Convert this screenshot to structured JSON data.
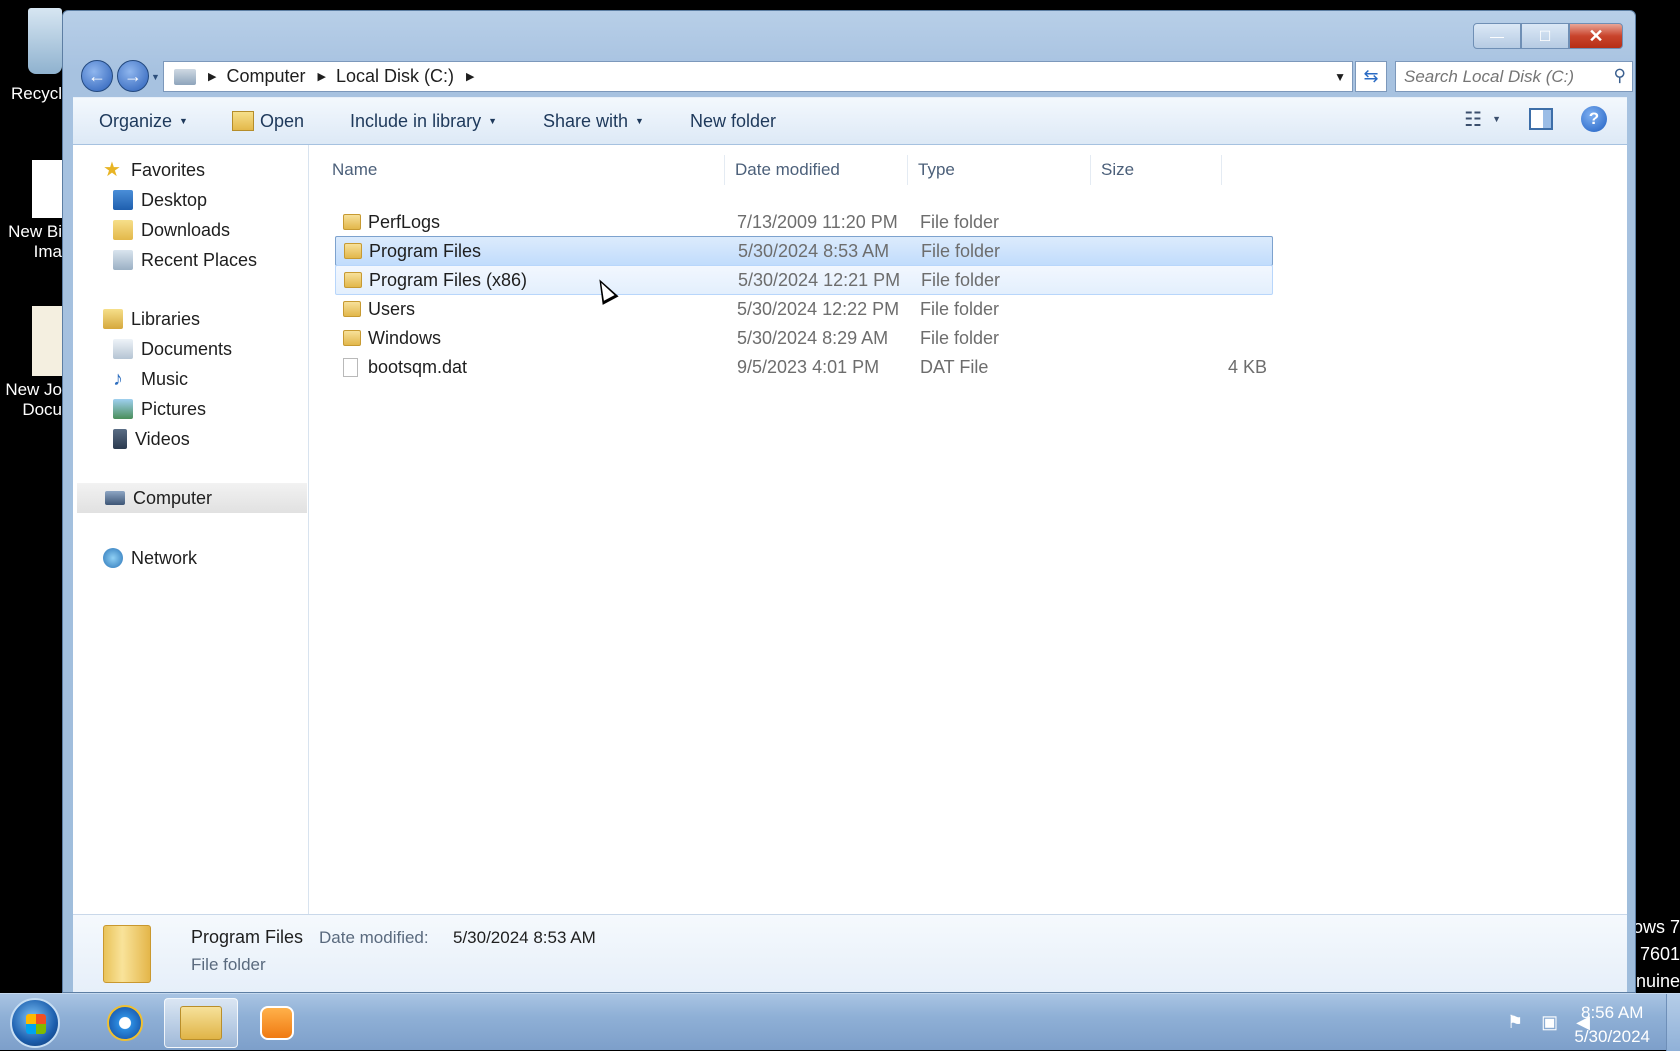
{
  "desktop": {
    "icons": [
      {
        "label": "Recycl",
        "icon": "recycle-bin-icon"
      },
      {
        "label_line1": "New Bi",
        "label_line2": "Ima",
        "icon": "bitmap-image-icon"
      },
      {
        "label_line1": "New Jo",
        "label_line2": "Docu",
        "icon": "journal-document-icon"
      }
    ],
    "watermark": [
      "ows 7",
      "7601",
      "nuine"
    ]
  },
  "window": {
    "caption_buttons": {
      "minimize": "—",
      "maximize": "☐",
      "close": "✕"
    }
  },
  "nav": {
    "back": "←",
    "forward": "→",
    "breadcrumb": [
      "Computer",
      "Local Disk (C:)"
    ],
    "search_placeholder": "Search Local Disk (C:)"
  },
  "toolbar": {
    "organize": "Organize",
    "open": "Open",
    "include_in_library": "Include in library",
    "share_with": "Share with",
    "new_folder": "New folder",
    "help": "?"
  },
  "sidebar": {
    "favorites": "Favorites",
    "desktop": "Desktop",
    "downloads": "Downloads",
    "recent_places": "Recent Places",
    "libraries": "Libraries",
    "documents": "Documents",
    "music": "Music",
    "pictures": "Pictures",
    "videos": "Videos",
    "computer": "Computer",
    "network": "Network"
  },
  "columns": {
    "name": "Name",
    "date_modified": "Date modified",
    "type": "Type",
    "size": "Size"
  },
  "files": [
    {
      "name": "PerfLogs",
      "date": "7/13/2009 11:20 PM",
      "type": "File folder",
      "size": "",
      "kind": "folder"
    },
    {
      "name": "Program Files",
      "date": "5/30/2024 8:53 AM",
      "type": "File folder",
      "size": "",
      "kind": "folder",
      "state": "selected"
    },
    {
      "name": "Program Files (x86)",
      "date": "5/30/2024 12:21 PM",
      "type": "File folder",
      "size": "",
      "kind": "folder",
      "state": "hover"
    },
    {
      "name": "Users",
      "date": "5/30/2024 12:22 PM",
      "type": "File folder",
      "size": "",
      "kind": "folder"
    },
    {
      "name": "Windows",
      "date": "5/30/2024 8:29 AM",
      "type": "File folder",
      "size": "",
      "kind": "folder"
    },
    {
      "name": "bootsqm.dat",
      "date": "9/5/2023 4:01 PM",
      "type": "DAT File",
      "size": "4 KB",
      "kind": "file"
    }
  ],
  "details": {
    "name": "Program Files",
    "date_label": "Date modified:",
    "date_value": "5/30/2024 8:53 AM",
    "type": "File folder"
  },
  "taskbar": {
    "time": "8:56 AM",
    "date": "5/30/2024"
  }
}
